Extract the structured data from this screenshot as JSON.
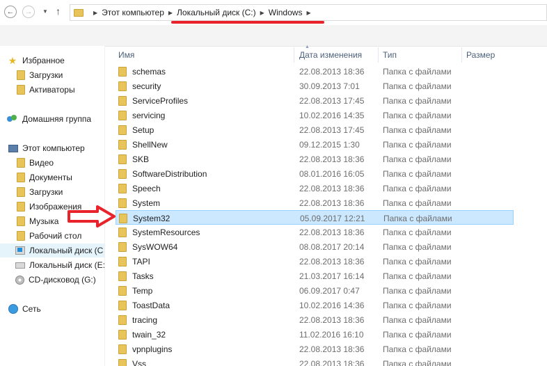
{
  "toolbar": {
    "back_icon": "back-arrow-icon",
    "forward_icon": "forward-arrow-icon",
    "recent_icon": "chevron-down-icon",
    "up_icon": "up-arrow-icon",
    "breadcrumb": [
      "Этот компьютер",
      "Локальный диск (C:)",
      "Windows"
    ]
  },
  "sidebar": {
    "items": [
      {
        "label": "Избранное",
        "icon": "star-icon"
      },
      {
        "label": "Загрузки",
        "icon": "folder-icon"
      },
      {
        "label": "Активаторы",
        "icon": "folder-icon"
      },
      {
        "label": "Домашняя группа",
        "icon": "homegroup-icon"
      },
      {
        "label": "Этот компьютер",
        "icon": "computer-icon"
      },
      {
        "label": "Видео",
        "icon": "folder-icon"
      },
      {
        "label": "Документы",
        "icon": "folder-icon"
      },
      {
        "label": "Загрузки",
        "icon": "folder-icon"
      },
      {
        "label": "Изображения",
        "icon": "folder-icon"
      },
      {
        "label": "Музыка",
        "icon": "folder-icon"
      },
      {
        "label": "Рабочий стол",
        "icon": "folder-icon"
      },
      {
        "label": "Локальный диск (C",
        "icon": "windows-drive-icon"
      },
      {
        "label": "Локальный диск (E:",
        "icon": "drive-icon"
      },
      {
        "label": "CD-дисковод (G:)",
        "icon": "cd-drive-icon"
      },
      {
        "label": "Сеть",
        "icon": "network-icon"
      }
    ]
  },
  "columns": {
    "name": "Имя",
    "date": "Дата изменения",
    "type": "Тип",
    "size": "Размер"
  },
  "files": [
    {
      "name": "schemas",
      "date": "22.08.2013 18:36",
      "type": "Папка с файлами"
    },
    {
      "name": "security",
      "date": "30.09.2013 7:01",
      "type": "Папка с файлами"
    },
    {
      "name": "ServiceProfiles",
      "date": "22.08.2013 17:45",
      "type": "Папка с файлами"
    },
    {
      "name": "servicing",
      "date": "10.02.2016 14:35",
      "type": "Папка с файлами"
    },
    {
      "name": "Setup",
      "date": "22.08.2013 17:45",
      "type": "Папка с файлами"
    },
    {
      "name": "ShellNew",
      "date": "09.12.2015 1:30",
      "type": "Папка с файлами"
    },
    {
      "name": "SKB",
      "date": "22.08.2013 18:36",
      "type": "Папка с файлами"
    },
    {
      "name": "SoftwareDistribution",
      "date": "08.01.2016 16:05",
      "type": "Папка с файлами"
    },
    {
      "name": "Speech",
      "date": "22.08.2013 18:36",
      "type": "Папка с файлами"
    },
    {
      "name": "System",
      "date": "22.08.2013 18:36",
      "type": "Папка с файлами"
    },
    {
      "name": "System32",
      "date": "05.09.2017 12:21",
      "type": "Папка с файлами",
      "selected": true
    },
    {
      "name": "SystemResources",
      "date": "22.08.2013 18:36",
      "type": "Папка с файлами"
    },
    {
      "name": "SysWOW64",
      "date": "08.08.2017 20:14",
      "type": "Папка с файлами"
    },
    {
      "name": "TAPI",
      "date": "22.08.2013 18:36",
      "type": "Папка с файлами"
    },
    {
      "name": "Tasks",
      "date": "21.03.2017 16:14",
      "type": "Папка с файлами"
    },
    {
      "name": "Temp",
      "date": "06.09.2017 0:47",
      "type": "Папка с файлами"
    },
    {
      "name": "ToastData",
      "date": "10.02.2016 14:36",
      "type": "Папка с файлами"
    },
    {
      "name": "tracing",
      "date": "22.08.2013 18:36",
      "type": "Папка с файлами"
    },
    {
      "name": "twain_32",
      "date": "11.02.2016 16:10",
      "type": "Папка с файлами"
    },
    {
      "name": "vpnplugins",
      "date": "22.08.2013 18:36",
      "type": "Папка с файлами"
    },
    {
      "name": "Vss",
      "date": "22.08.2013 18:36",
      "type": "Папка с файлами"
    }
  ],
  "colors": {
    "selection_bg": "#cce8ff",
    "selection_border": "#99d1ff",
    "annotation_red": "#e8232b",
    "folder_yellow": "#e8c55a"
  }
}
